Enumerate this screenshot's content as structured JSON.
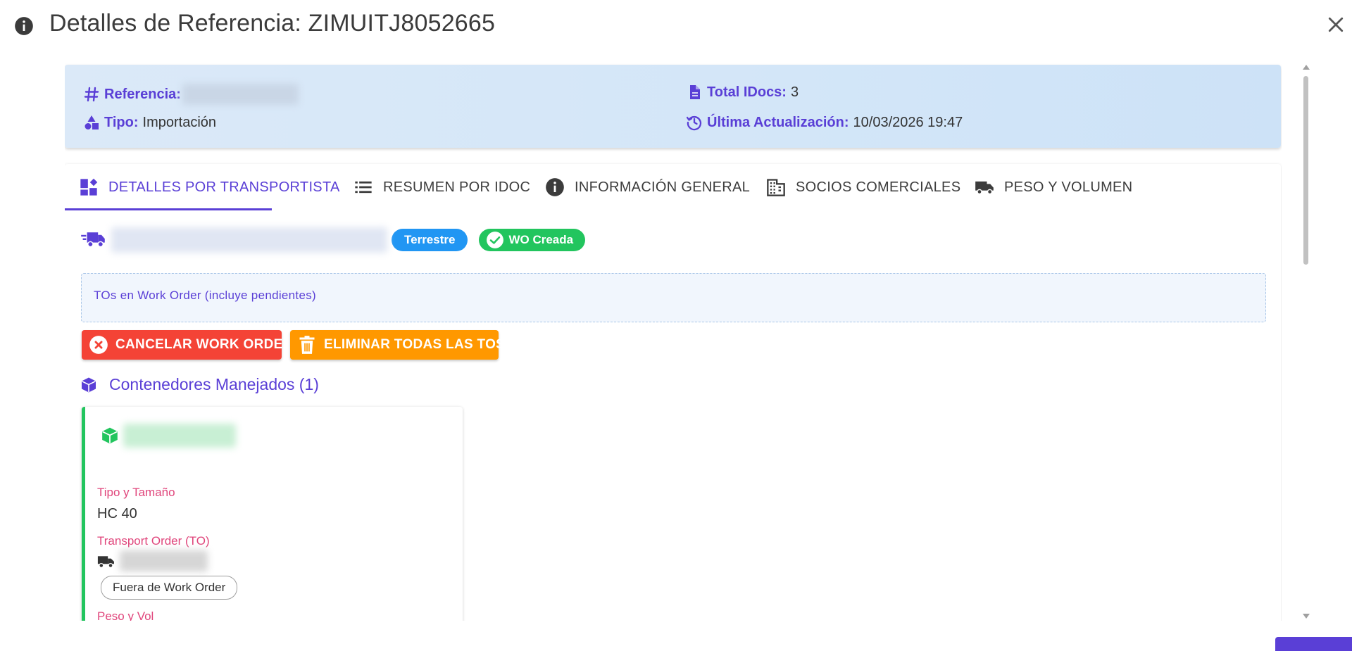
{
  "dialog": {
    "title": "Detalles de Referencia: ZIMUITJ8052665"
  },
  "summary": {
    "referencia_label": "Referencia:",
    "tipo_label": "Tipo:",
    "tipo_value": "Importación",
    "total_idocs_label": "Total IDocs:",
    "total_idocs_value": "3",
    "ultima_label": "Última Actualización:",
    "ultima_value": "10/03/2026 19:47"
  },
  "tabs": [
    {
      "label": "DETALLES POR TRANSPORTISTA",
      "icon": "dashboard-icon",
      "active": true
    },
    {
      "label": "RESUMEN POR IDOC",
      "icon": "list-icon",
      "active": false
    },
    {
      "label": "INFORMACIÓN GENERAL",
      "icon": "info-icon",
      "active": false
    },
    {
      "label": "SOCIOS COMERCIALES",
      "icon": "building-icon",
      "active": false
    },
    {
      "label": "PESO Y VOLUMEN",
      "icon": "truck-icon",
      "active": false
    }
  ],
  "carrier": {
    "mode_chip": "Terrestre",
    "status_chip": "WO Creada"
  },
  "to_box": {
    "text": "TOs en Work Order (incluye pendientes)"
  },
  "actions": {
    "cancel_label": "CANCELAR WORK ORDER",
    "delete_label": "ELIMINAR TODAS LAS TOS"
  },
  "containers": {
    "title": "Contenedores Manejados (1)",
    "card": {
      "tipo_label": "Tipo y Tamaño",
      "tipo_value": "HC 40",
      "to_label": "Transport Order (TO)",
      "to_status_chip": "Fuera de Work Order",
      "next_label_partial": "Peso y Vol"
    }
  },
  "colors": {
    "accent": "#5a3fd6",
    "terrestre": "#2196f3",
    "success": "#22c55e",
    "danger": "#f44336",
    "warning": "#ff9800",
    "field_label": "#e0457b"
  }
}
